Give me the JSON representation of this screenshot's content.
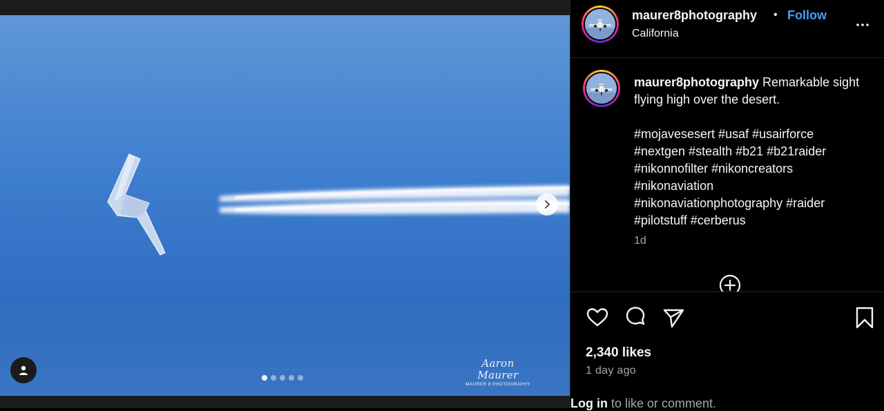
{
  "post": {
    "username": "maurer8photography",
    "separator": "•",
    "follow_label": "Follow",
    "location": "California",
    "more_icon": "more-horizontal-icon"
  },
  "media": {
    "watermark_name": "Aaron Maurer",
    "watermark_sub": "MAURER 8 PHOTOGRAPHY",
    "carousel_total": 5,
    "carousel_active": 1,
    "next_icon": "chevron-right-icon",
    "user_tag_icon": "person-icon"
  },
  "caption": {
    "username": "maurer8photography",
    "text": "Remarkable sight flying high over the desert.",
    "hashtags": "#mojavesesert #usaf #usairforce #nextgen #stealth #b21 #b21raider #nikonnofilter #nikoncreators #nikonaviation #nikonaviationphotography #raider #pilotstuff #cerberus",
    "time": "1d"
  },
  "actions": {
    "like_icon": "heart-icon",
    "comment_icon": "comment-icon",
    "share_icon": "paper-plane-icon",
    "save_icon": "bookmark-icon",
    "load_more_icon": "plus-circle-icon"
  },
  "stats": {
    "likes": "2,340 likes",
    "date": "1 day ago"
  },
  "login_prompt": {
    "link": "Log in",
    "rest": " to like or comment."
  }
}
